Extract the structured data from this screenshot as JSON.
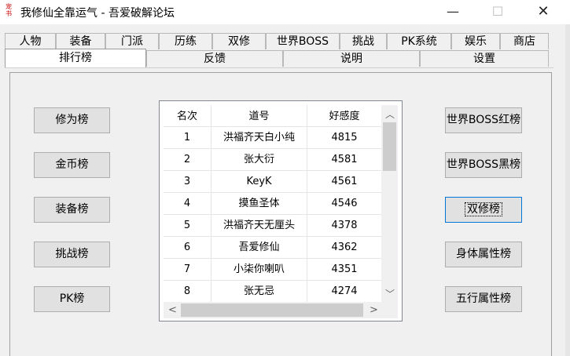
{
  "window": {
    "title": "我修仙全靠运气 - 吾爱破解论坛",
    "icon_text": "宠 书",
    "minimize": "—",
    "maximize": "☐",
    "close": "✕"
  },
  "tabs_row1": [
    "人物",
    "装备",
    "门派",
    "历练",
    "双修",
    "世界BOSS",
    "挑战",
    "PK系统",
    "娱乐",
    "商店"
  ],
  "tabs_row2": [
    "排行榜",
    "反馈",
    "说明",
    "设置"
  ],
  "selected_tab": "排行榜",
  "left_buttons": [
    "修为榜",
    "金币榜",
    "装备榜",
    "挑战榜",
    "PK榜"
  ],
  "right_buttons": [
    "世界BOSS红榜",
    "世界BOSS黑榜",
    "双修榜",
    "身体属性榜",
    "五行属性榜"
  ],
  "focused_button": "双修榜",
  "table": {
    "headers": [
      "名次",
      "道号",
      "好感度"
    ],
    "rows": [
      [
        "1",
        "洪福齐天白小纯",
        "4815"
      ],
      [
        "2",
        "张大衍",
        "4581"
      ],
      [
        "3",
        "KeyK",
        "4561"
      ],
      [
        "4",
        "摸鱼圣体",
        "4546"
      ],
      [
        "5",
        "洪福齐天无厘头",
        "4378"
      ],
      [
        "6",
        "吾爱修仙",
        "4362"
      ],
      [
        "7",
        "小柒你喇叭",
        "4351"
      ],
      [
        "8",
        "张无忌",
        "4274"
      ]
    ]
  },
  "scroll": {
    "up": "︿",
    "down": "﹀",
    "left": "<",
    "right": ">"
  }
}
